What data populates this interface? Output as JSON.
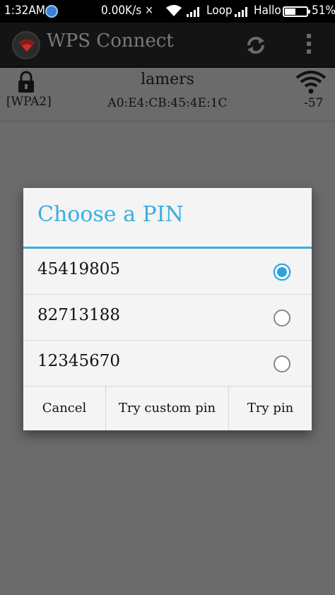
{
  "status_bar": {
    "time": "1:32AM",
    "network_speed": "0.00K/s",
    "carrier1": "Loop",
    "carrier2": "Hallo",
    "battery_percent": "51%",
    "battery_level": 0.51
  },
  "app_bar": {
    "title": "WPS Connect",
    "icons": [
      "app-logo-icon",
      "refresh-icon",
      "overflow-menu-icon"
    ]
  },
  "network": {
    "ssid": "lamers",
    "security": "[WPA2]",
    "bssid": "A0:E4:CB:45:4E:1C",
    "signal": "-57"
  },
  "dialog": {
    "title": "Choose a PIN",
    "options": [
      {
        "pin": "45419805",
        "selected": true
      },
      {
        "pin": "82713188",
        "selected": false
      },
      {
        "pin": "12345670",
        "selected": false
      }
    ],
    "buttons": {
      "cancel": "Cancel",
      "custom": "Try custom pin",
      "try": "Try pin"
    }
  },
  "colors": {
    "accent": "#39aee0",
    "overlay": "#6b6b6b",
    "dialog_bg": "#f4f4f4"
  }
}
